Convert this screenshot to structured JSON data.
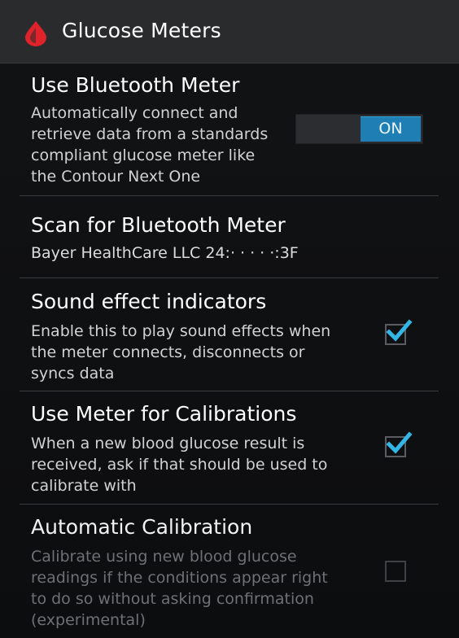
{
  "header": {
    "title": "Glucose Meters",
    "icon": "blood-drop-icon",
    "accent": "#e0232a"
  },
  "settings": [
    {
      "title": "Use Bluetooth Meter",
      "summary": [
        "Automatically connect and",
        "retrieve data from a standards",
        "compliant glucose meter like",
        "the Contour Next One"
      ],
      "control": "toggle",
      "toggle_label": "ON",
      "enabled": true
    },
    {
      "title": "Scan for Bluetooth Meter",
      "summary": [
        "Bayer HealthCare LLC    24:·   ·  ·  ·  ·:3F"
      ],
      "control": "none"
    },
    {
      "title": "Sound effect indicators",
      "summary": [
        "Enable this to play sound effects when",
        "the meter connects, disconnects or",
        "syncs data"
      ],
      "control": "checkbox",
      "checked": true
    },
    {
      "title": "Use Meter for Calibrations",
      "summary": [
        "When a new blood glucose result is",
        "received, ask if that should be used to",
        "calibrate with"
      ],
      "control": "checkbox",
      "checked": true
    },
    {
      "title": "Automatic Calibration",
      "summary": [
        "Calibrate using new blood glucose",
        "readings if the conditions appear right",
        "to do so without asking confirmation",
        "(experimental)"
      ],
      "control": "checkbox",
      "checked": false,
      "disabled": true
    }
  ],
  "colors": {
    "toggle_on": "#1f7fb4",
    "check_accent": "#33b5e5",
    "divider": "#3a3c40"
  }
}
